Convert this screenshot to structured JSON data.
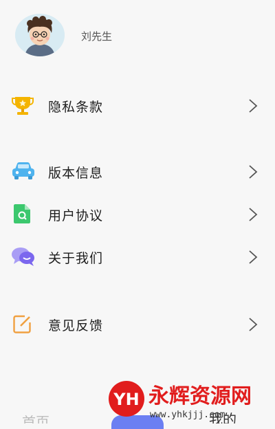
{
  "profile": {
    "username": "刘先生"
  },
  "menu": {
    "privacy": {
      "label": "隐私条款"
    },
    "version": {
      "label": "版本信息"
    },
    "agreement": {
      "label": "用户协议"
    },
    "about": {
      "label": "关于我们"
    },
    "feedback": {
      "label": "意见反馈"
    }
  },
  "bottom_nav": {
    "left_label": "首页",
    "right_label": "我的"
  },
  "watermark": {
    "logo_text": "YH",
    "brand": "永辉资源网",
    "url": "www.yhkjjj.com"
  },
  "colors": {
    "background": "#f7f7f7",
    "trophy": "#f4b400",
    "car": "#4fb3ee",
    "doc": "#3cc86e",
    "chat": "#8d7cf0",
    "note": "#f0a040",
    "nav_accent": "#6b7ff2",
    "watermark_red": "#e11d1d"
  }
}
